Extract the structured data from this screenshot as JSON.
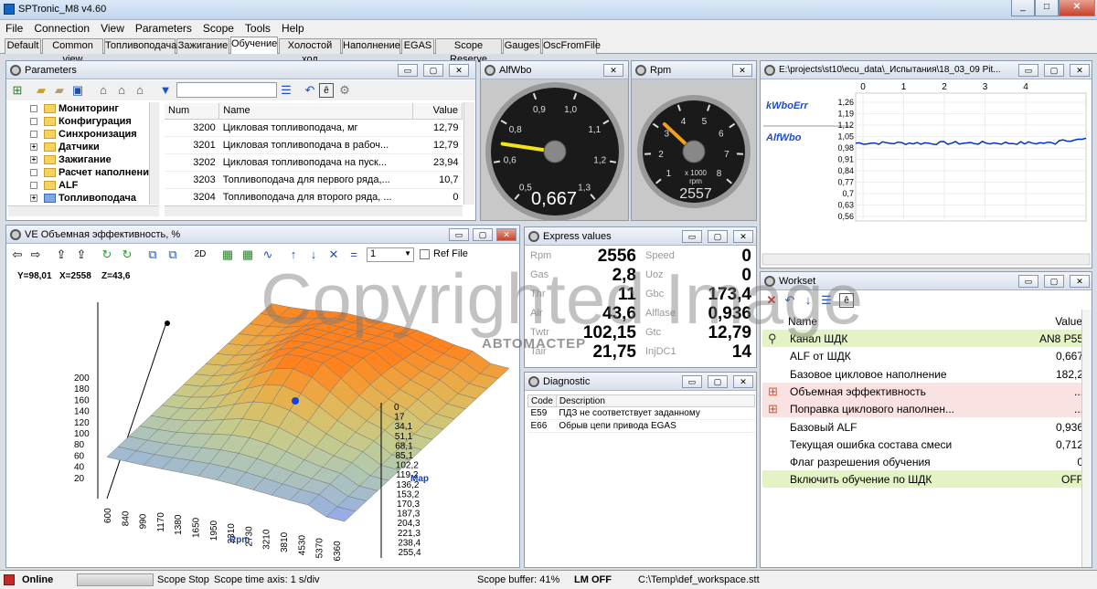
{
  "app": {
    "title": "SPTronic_M8 v4.60"
  },
  "menu": [
    "File",
    "Connection",
    "View",
    "Parameters",
    "Scope",
    "Tools",
    "Help"
  ],
  "tabs": [
    "Default",
    "Common view",
    "Топливоподача",
    "Зажигание",
    "Обучение",
    "Холостой ход",
    "Наполнение",
    "EGAS",
    "Scope Reserve",
    "Gauges",
    "OscFromFile"
  ],
  "active_tab": "Обучение",
  "parameters": {
    "title": "Parameters",
    "tree": [
      {
        "label": "Мониторинг",
        "expander": ""
      },
      {
        "label": "Конфигурация",
        "expander": ""
      },
      {
        "label": "Синхронизация",
        "expander": ""
      },
      {
        "label": "Датчики",
        "expander": "+"
      },
      {
        "label": "Зажигание",
        "expander": "+"
      },
      {
        "label": "Расчет наполнени",
        "expander": ""
      },
      {
        "label": "ALF",
        "expander": ""
      },
      {
        "label": "Топливоподача",
        "expander": "+"
      }
    ],
    "headers": [
      "Num",
      "Name",
      "Value"
    ],
    "rows": [
      [
        "3200",
        "Цикловая топливоподача, мг",
        "12,79"
      ],
      [
        "3201",
        "Цикловая топливоподача в рабоч...",
        "12,79"
      ],
      [
        "3202",
        "Цикловая топливоподача на пуск...",
        "23,94"
      ],
      [
        "3203",
        "Топливоподача для первого ряда,...",
        "10,7"
      ],
      [
        "3204",
        "Топливоподача для второго ряда, ...",
        "0"
      ]
    ]
  },
  "alfwbo": {
    "title": "AlfWbo",
    "value": "0,667",
    "ticks": [
      "0,5",
      "0,6",
      "0,8",
      "0,9",
      "1,0",
      "1,1",
      "1,2",
      "1,3"
    ],
    "needle": 0.667,
    "min": 0.5,
    "max": 1.3
  },
  "rpm": {
    "title": "Rpm",
    "value": "2557",
    "unit_line1": "x 1000",
    "unit_line2": "rpm",
    "ticks": [
      "1",
      "2",
      "3",
      "4",
      "5",
      "6",
      "7",
      "8"
    ],
    "needle": 2.557,
    "min": 0,
    "max": 8
  },
  "scope": {
    "title": "E:\\projects\\st10\\ecu_data\\_Испытания\\18_03_09 Pit...",
    "x_ticks": [
      "0",
      "1",
      "2",
      "3",
      "4"
    ],
    "y_ticks": [
      "1,26",
      "1,19",
      "1,12",
      "1,05",
      "0,98",
      "0,91",
      "0,84",
      "0,77",
      "0,7",
      "0,63",
      "0,56"
    ],
    "series_labels": [
      "kWboErr",
      "AlfWbo"
    ]
  },
  "ve": {
    "title": "VE  Объемная эффективность, %",
    "coords": {
      "y": "Y=98,01",
      "x": "X=2558",
      "z": "Z=43,6"
    },
    "toolbar_2d": "2D",
    "combo_value": "1",
    "ref_file": "Ref File",
    "z_ticks": [
      "200",
      "180",
      "160",
      "140",
      "120",
      "100",
      "80",
      "60",
      "40",
      "20"
    ],
    "rpm_ticks": [
      "600",
      "840",
      "990",
      "1170",
      "1380",
      "1650",
      "1950",
      "2310",
      "2730",
      "3210",
      "3810",
      "4530",
      "5370",
      "6360"
    ],
    "map_ticks": [
      "0",
      "17",
      "34,1",
      "51,1",
      "68,1",
      "85,1",
      "102,2",
      "119,2",
      "136,2",
      "153,2",
      "170,3",
      "187,3",
      "204,3",
      "221,3",
      "238,4",
      "255,4"
    ],
    "x_axis_label": "Rpm",
    "y_axis_label": "Map"
  },
  "express": {
    "title": "Express values",
    "left": [
      [
        "Rpm",
        "2556"
      ],
      [
        "Gas",
        "2,8"
      ],
      [
        "Thr",
        "11"
      ],
      [
        "Air",
        "43,6"
      ],
      [
        "Twtr",
        "102,15"
      ],
      [
        "Tair",
        "21,75"
      ]
    ],
    "right": [
      [
        "Speed",
        "0"
      ],
      [
        "Uoz",
        "0"
      ],
      [
        "Gbc",
        "173,4"
      ],
      [
        "Alflase",
        "0,936"
      ],
      [
        "Gtc",
        "12,79"
      ],
      [
        "InjDC1",
        "14"
      ]
    ]
  },
  "diagnostic": {
    "title": "Diagnostic",
    "headers": [
      "Code",
      "Description"
    ],
    "rows": [
      [
        "E59",
        "ПДЗ не соответствует заданному"
      ],
      [
        "E66",
        "Обрыв цепи привода EGAS"
      ]
    ]
  },
  "workset": {
    "title": "Workset",
    "headers": [
      "Name",
      "Value"
    ],
    "rows": [
      {
        "name": "Канал ШДК",
        "value": "AN8  P55",
        "bg": "#e4f3c4",
        "icon": "pin"
      },
      {
        "name": "ALF от ШДК",
        "value": "0,667",
        "bg": "#ffffff",
        "icon": ""
      },
      {
        "name": "Базовое цикловое наполнение",
        "value": "182,2",
        "bg": "#ffffff",
        "icon": ""
      },
      {
        "name": "Объемная эффективность",
        "value": "...",
        "bg": "#fbe2e2",
        "icon": "table"
      },
      {
        "name": "Поправка циклового наполнен...",
        "value": "...",
        "bg": "#fbe2e2",
        "icon": "table"
      },
      {
        "name": "Базовый ALF",
        "value": "0,936",
        "bg": "#ffffff",
        "icon": ""
      },
      {
        "name": "Текущая ошибка состава смеси",
        "value": "0,712",
        "bg": "#ffffff",
        "icon": ""
      },
      {
        "name": "Флаг разрешения обучения",
        "value": "0",
        "bg": "#ffffff",
        "icon": ""
      },
      {
        "name": "Включить обучение по ШДК",
        "value": "OFF",
        "bg": "#e4f3c4",
        "icon": ""
      }
    ]
  },
  "status": {
    "online": "Online",
    "scope_stop": "Scope Stop",
    "time_axis": "Scope time axis: 1 s/div",
    "buffer": "Scope buffer: 41%",
    "lm": "LM OFF",
    "workspace": "C:\\Temp\\def_workspace.stt"
  },
  "watermark": {
    "text": "Copyrighted Image",
    "brand": "АВТОМАСТЕР"
  }
}
